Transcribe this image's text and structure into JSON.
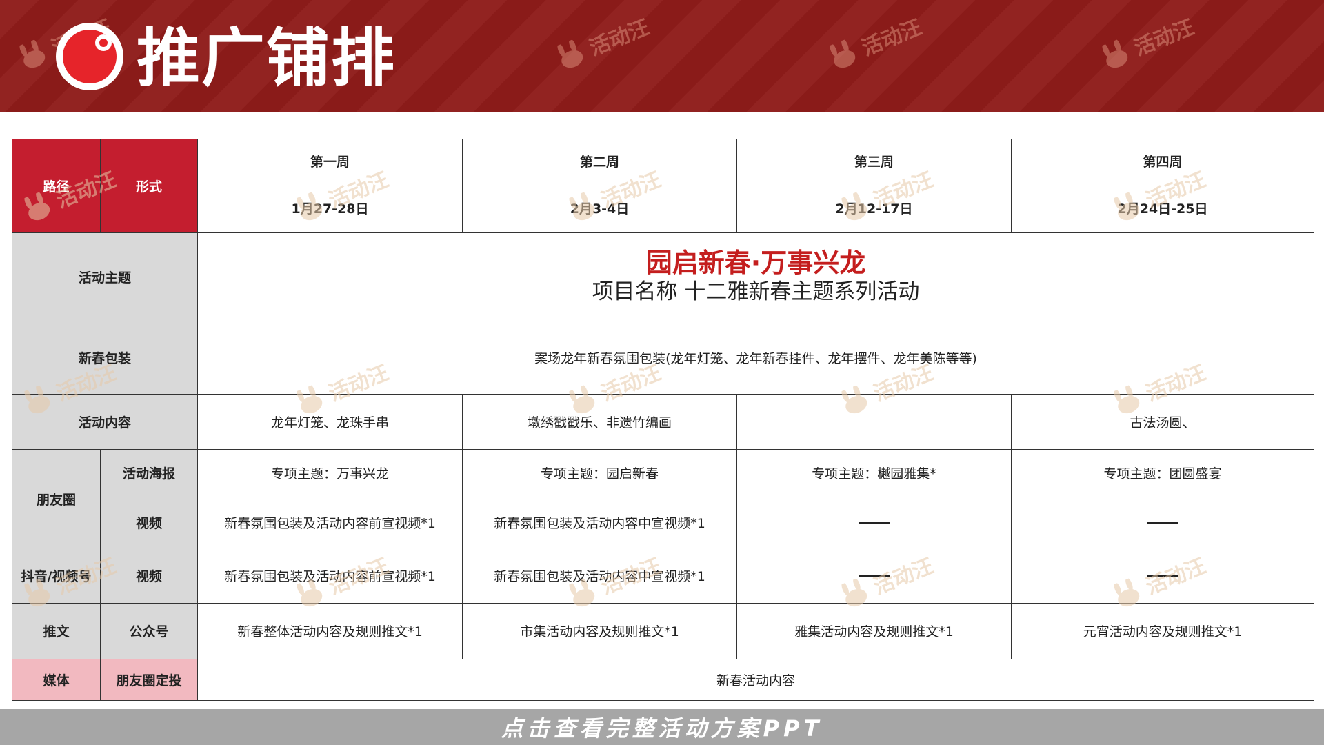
{
  "header": {
    "title": "推广铺排",
    "bg_color": "#8e1c1a",
    "logo_icon": "red-ring-logo-icon"
  },
  "watermark": {
    "text": "活动汪",
    "icon": "bunny-mascot-icon"
  },
  "table": {
    "head": {
      "path_label": "路径",
      "form_label": "形式",
      "weeks": [
        "第一周",
        "第二周",
        "第三周",
        "第四周"
      ],
      "dates": [
        "1月27-28日",
        "2月3-4日",
        "2月12-17日",
        "2月24日-25日"
      ]
    },
    "theme_row": {
      "label": "活动主题",
      "main": "园启新春·万事兴龙",
      "sub": "项目名称  十二雅新春主题系列活动"
    },
    "package_row": {
      "label": "新春包装",
      "text": "案场龙年新春氛围包装(龙年灯笼、龙年新春挂件、龙年摆件、龙年美陈等等)"
    },
    "content_row": {
      "label": "活动内容",
      "cells": [
        "龙年灯笼、龙珠手串",
        "墩绣戳戳乐、非遗竹编画",
        "",
        "古法汤圆、"
      ]
    },
    "moments": {
      "group_label": "朋友圈",
      "poster_label": "活动海报",
      "poster_cells": [
        "专项主题：万事兴龙",
        "专项主题：园启新春",
        "专项主题：樾园雅集*",
        "专项主题：团圆盛宴"
      ],
      "video_label": "视频",
      "video_cells": [
        "新春氛围包装及活动内容前宣视频*1",
        "新春氛围包装及活动内容中宣视频*1",
        "——",
        "——"
      ]
    },
    "douyin": {
      "group_label": "抖音/视频号",
      "form_label": "视频",
      "cells": [
        "新春氛围包装及活动内容前宣视频*1",
        "新春氛围包装及活动内容中宣视频*1",
        "——",
        "——"
      ]
    },
    "article": {
      "group_label": "推文",
      "form_label": "公众号",
      "cells": [
        "新春整体活动内容及规则推文*1",
        "市集活动内容及规则推文*1",
        "雅集活动内容及规则推文*1",
        "元宵活动内容及规则推文*1"
      ]
    },
    "media": {
      "group_label": "媒体",
      "form_label": "朋友圈定投",
      "text": "新春活动内容"
    }
  },
  "footer": {
    "cta": "点击查看完整活动方案PPT"
  },
  "colors": {
    "header_red": "#8e1c1a",
    "label_red": "#c41e2f",
    "label_gray": "#d9d9d9",
    "label_pink": "#f2b9c0",
    "theme_red": "#c41e1e",
    "footer_gray": "#a6a6a6"
  }
}
